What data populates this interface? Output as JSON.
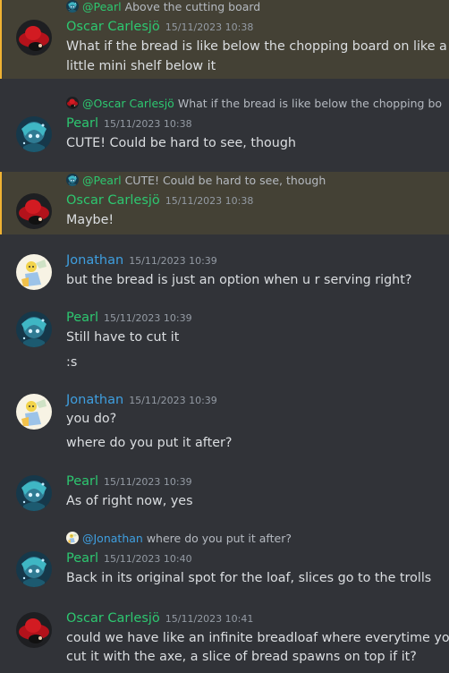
{
  "colors": {
    "oscar": "#2dc770",
    "pearl": "#2dc770",
    "jonathan": "#3f9fe0",
    "mention_bg": "#444135",
    "mention_bar": "#f0b232"
  },
  "messages": [
    {
      "reply": {
        "name": "@Pearl",
        "text": "Above the cutting board"
      },
      "author": "Oscar Carlesjö",
      "timestamp": "15/11/2023 10:38",
      "lines": [
        "What if the bread is like below the chopping board on like a",
        "little mini shelf below it"
      ]
    },
    {
      "reply": {
        "name": "@Oscar Carlesjö",
        "text": "What if the bread is like below the chopping boar"
      },
      "author": "Pearl",
      "timestamp": "15/11/2023 10:38",
      "lines": [
        "CUTE! Could be hard to see, though"
      ]
    },
    {
      "reply": {
        "name": "@Pearl",
        "text": "CUTE! Could be hard to see, though"
      },
      "author": "Oscar Carlesjö",
      "timestamp": "15/11/2023 10:38",
      "lines": [
        "Maybe!"
      ]
    },
    {
      "author": "Jonathan",
      "timestamp": "15/11/2023 10:39",
      "lines": [
        "but the bread is just an option when u r serving right?"
      ]
    },
    {
      "author": "Pearl",
      "timestamp": "15/11/2023 10:39",
      "lines": [
        "Still have to cut it",
        ":s"
      ]
    },
    {
      "author": "Jonathan",
      "timestamp": "15/11/2023 10:39",
      "lines": [
        "you do?",
        "where do you put it after?"
      ]
    },
    {
      "author": "Pearl",
      "timestamp": "15/11/2023 10:39",
      "lines": [
        "As of right now, yes"
      ]
    },
    {
      "reply": {
        "name": "@Jonathan",
        "text": "where do you put it after?"
      },
      "author": "Pearl",
      "timestamp": "15/11/2023 10:40",
      "lines": [
        "Back in its original spot for the loaf, slices go to the trolls"
      ]
    },
    {
      "author": "Oscar Carlesjö",
      "timestamp": "15/11/2023 10:41",
      "lines": [
        "could we have like an infinite breadloaf where everytime you",
        "cut it with the axe, a slice of bread spawns on top if it?"
      ]
    }
  ]
}
